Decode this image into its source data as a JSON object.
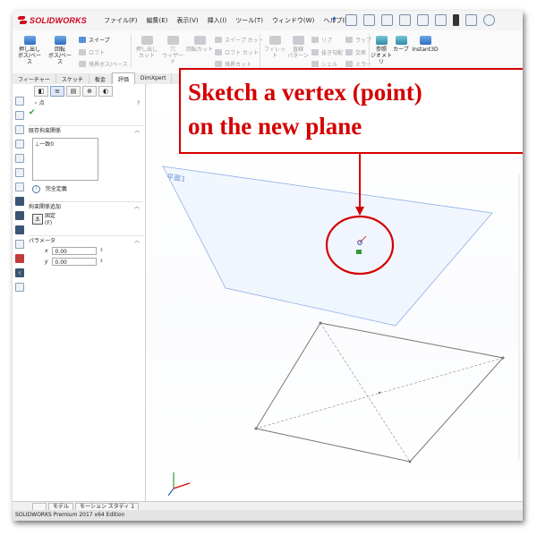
{
  "app": {
    "logo_text": "SOLIDWORKS",
    "logo_color": "#d0021b"
  },
  "menu": {
    "items": [
      "ファイル(F)",
      "編集(E)",
      "表示(V)",
      "挿入(I)",
      "ツール(T)",
      "ウィンドウ(W)",
      "ヘルプ(H)"
    ]
  },
  "ribbon": {
    "extrude_boss": [
      "押し出し",
      "ボス/ベース"
    ],
    "revolve_boss": [
      "回転",
      "ボス/ベース"
    ],
    "sweep": "スイープ",
    "loft": "ロフト",
    "boundary": "境界ボス/ベース",
    "extrude_cut": [
      "押し出し",
      "カット"
    ],
    "hole_wizard": [
      "穴",
      "ウィザード"
    ],
    "revolve_cut": [
      "回転カット",
      ""
    ],
    "swept_cut": "スイープ カット",
    "lofted_cut": "ロフト カット",
    "boundary_cut": "境界カット",
    "fillet": "フィレット",
    "linear_pattern": [
      "直線",
      "パターン"
    ],
    "rib": "リブ",
    "draft": "抜き勾配",
    "shell": "シェル",
    "wrap": "ラップ",
    "intersect": "交差",
    "mirror": "ミラー",
    "ref_geometry": [
      "参照",
      "ジオメトリ"
    ],
    "curves": "カーブ",
    "instant3d": "Instant3D"
  },
  "cm_tabs": [
    "フィーチャー",
    "スケッチ",
    "板金",
    "評価",
    "DimXpert"
  ],
  "cm_active_tab": 3,
  "pm": {
    "title": "点",
    "existing_relations_header": "既存拘束関係",
    "existing_relations": [
      "一致0"
    ],
    "status": "完全定義",
    "add_relations_header": "拘束関係追加",
    "fix_label": "固定",
    "fix_key": "(F)",
    "params_header": "パラメータ",
    "x_label": "x",
    "x_value": "0.00",
    "y_label": "y",
    "y_value": "0.00"
  },
  "graphics": {
    "plane_label": "平面1",
    "plane_color": "#8fb0e6",
    "accent_red": "#d40000"
  },
  "callout": {
    "line1": "Sketch a vertex (point)",
    "line2": "on the new plane"
  },
  "bottom_tabs": [
    "モデル",
    "モーション スタディ 1"
  ],
  "status_bar": "SOLIDWORKS Premium 2017 x64 Edition"
}
